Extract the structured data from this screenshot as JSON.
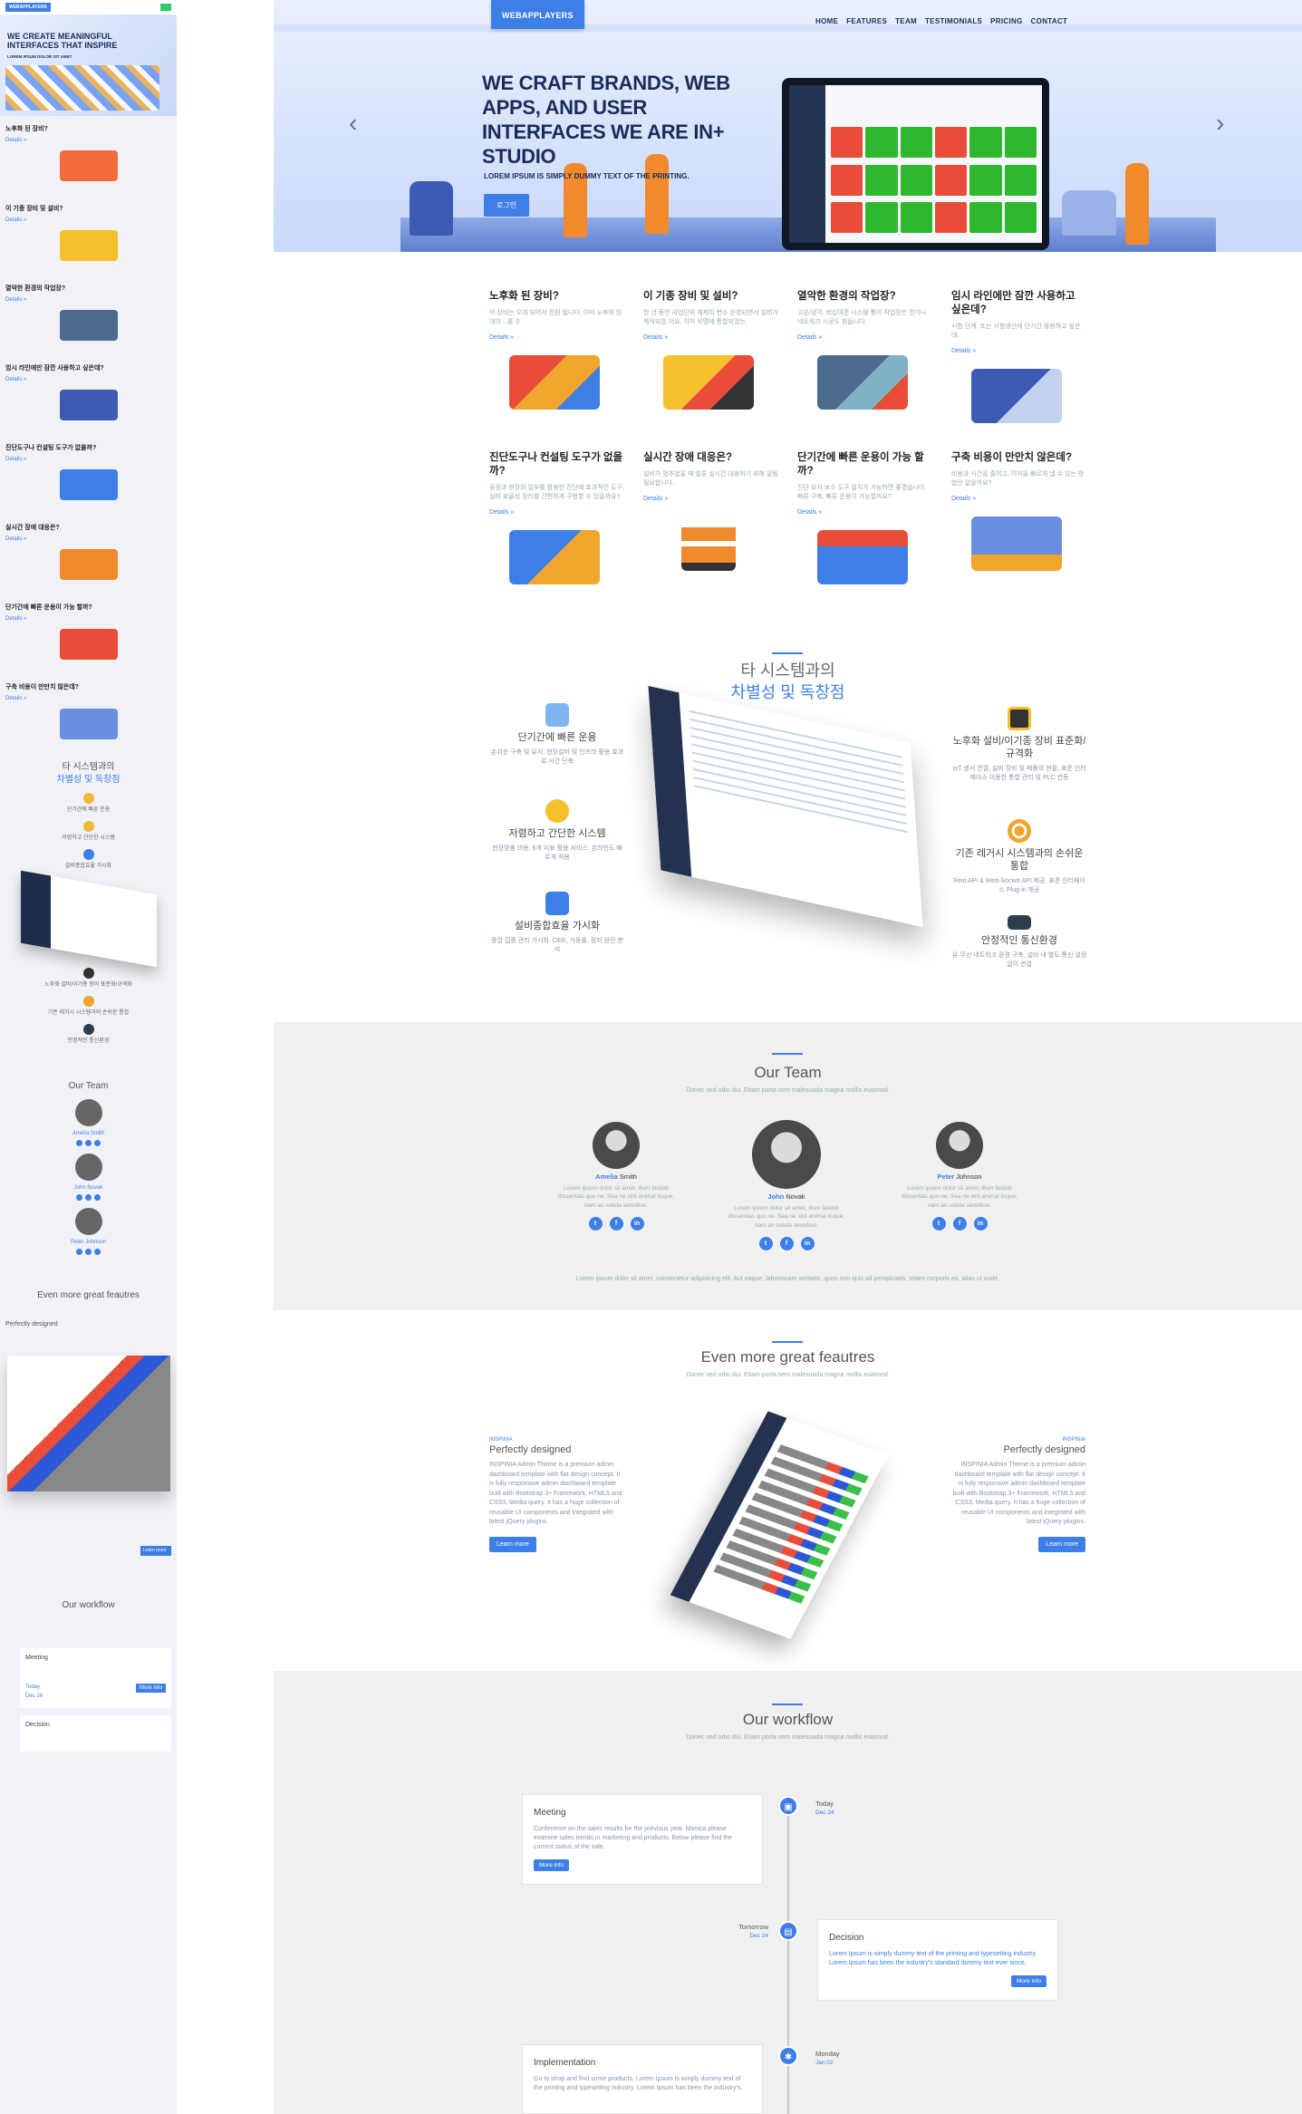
{
  "mobile": {
    "logo": "WEBAPPLAYERS",
    "hero_title": "WE CREATE MEANINGFUL INTERFACES THAT INSPIRE",
    "hero_sub": "LOREM IPSUM DOLOR SIT AMET",
    "sections": [
      {
        "title": "노후화 된 장비?",
        "link": "Details »"
      },
      {
        "title": "이 기종 장비 및 설비?",
        "link": "Details »"
      },
      {
        "title": "열악한 환경의 작업장?",
        "link": "Details »"
      },
      {
        "title": "임시 라인에만 잠깐 사용하고 싶은데?",
        "link": "Details »"
      },
      {
        "title": "진단도구나 컨설팅 도구가 없을까?",
        "link": "Details »"
      },
      {
        "title": "실시간 장애 대응은?",
        "link": "Details »"
      },
      {
        "title": "단기간에 빠른 운용이 가능 할까?",
        "link": "Details »"
      },
      {
        "title": "구축 비용이 만만치 않은데?",
        "link": "Details »"
      }
    ],
    "diff_title_1": "타 시스템과의",
    "diff_title_2": "차별성 및 독창점",
    "mini_items": [
      "단기간에 빠른 운용",
      "저렴하고 간단한 시스템",
      "설비종합효율 가시화"
    ],
    "mini_items_2": [
      "노후화 설비/이기종 장비 표준화/규격화",
      "기존 레거시 시스템과의 손쉬운 통합",
      "안정적인 통신환경"
    ],
    "team_title": "Our Team",
    "members": [
      "Amelia Smith",
      "John Novak",
      "Peter Johnson"
    ],
    "gf_title": "Even more great feautres",
    "gf_col": "Perfectly designed",
    "btn": "Learn more",
    "wf_title": "Our workflow",
    "wf_items": [
      "Meeting",
      "Decision"
    ],
    "wf_more": "More info",
    "wf_today": "Today",
    "wf_date": "Dec 24"
  },
  "nav": {
    "logo": "WEBAPPLAYERS",
    "items": [
      "HOME",
      "FEATURES",
      "TEAM",
      "TESTIMONIALS",
      "PRICING",
      "CONTACT"
    ]
  },
  "hero": {
    "title": "WE CRAFT BRANDS, WEB APPS, AND USER INTERFACES WE ARE IN+ STUDIO",
    "sub": "LOREM IPSUM IS SIMPLY DUMMY TEXT OF THE PRINTING.",
    "button": "로그인",
    "prev": "‹",
    "next": "›",
    "tile_colors": [
      "#e94d3a",
      "#2eb82e",
      "#2eb82e",
      "#e94d3a",
      "#2eb82e",
      "#2eb82e"
    ]
  },
  "features": [
    {
      "title": "노후화 된 장비?",
      "desc": "이 장비는 오래 되어서 전원 됩니다. 이미 노후화 된 데이…를 수",
      "link": "Details »"
    },
    {
      "title": "이 기종 장비 및 설비?",
      "desc": "한 년 동안 사업단위 체제의 변수 운영되면서 설비가 제작되었 어요. 이미 비명에 통합되었는",
      "link": "Details »"
    },
    {
      "title": "열악한 환경의 작업장?",
      "desc": "고온/냉각, 비십여준 시스템 통이 작업장은 전기나 네트워크 시공도 힘듭니다.",
      "link": "Details »"
    },
    {
      "title": "임시 라인에만 잠깐 사용하고 싶은데?",
      "desc": "시험 단계, 또는 시험생산에 단기간 활용하고 싶은데,",
      "link": "Details »"
    },
    {
      "title": "진단도구나 컨설팅 도구가 없을까?",
      "desc": "공정과 현장의 일부를 활용한 진단에 효과적인 도구, 설비 효율성 정리를 간편하게 구현할 수 있을까요?",
      "link": "Details »"
    },
    {
      "title": "실시간 장애 대응은?",
      "desc": "설비가 멈추었을 때 얼른 실시간 대응하기 위해 알림 필요합니다.",
      "link": "Details »"
    },
    {
      "title": "단기간에 빠른 운용이 가능 할까?",
      "desc": "진단 유지 보수 도구 설치가 가능하면 좋겠습니다. 빠른 구축, 빠른 운용이 가능할까요?",
      "link": "Details »"
    },
    {
      "title": "구축 비용이 만만치 않은데?",
      "desc": "비용과 시간을 줄이고, 이익을 빠르게 낼 수 있는 방법은 없을까요?",
      "link": "Details »"
    }
  ],
  "diff": {
    "title_1": "타 시스템과의",
    "title_2": "차별성 및 독창점",
    "left": [
      {
        "title": "단기간에 빠른 운용",
        "desc": "손쉬운 구축 및 유지, 현장설비 및 인프라 활용 효과로 시간 단축"
      },
      {
        "title": "저렴하고 간단한 시스템",
        "desc": "현장맞춤 비용, 6개 지표 활용 서비스, 온라인도 빠르게 적용"
      },
      {
        "title": "설비종합효율 가시화",
        "desc": "중앙 집중 관리 가시화, OEE, 가동률, 정지 원인 분석"
      }
    ],
    "right": [
      {
        "title": "노후화 설비/이기종 장비 표준화/규격화",
        "desc": "IoT 센서 연결, 설비 장비 및 제품의 현황, 표준 인터페이스 이용한 통합 관리 및 PLC 연동"
      },
      {
        "title": "기존 레거시 시스템과의 손쉬운 통합",
        "desc": "Rest API & Web-Socket API 제공, 표준 인터페이스 Plug-in 제공"
      },
      {
        "title": "안정적인 통신환경",
        "desc": "유·무선 네트워크 환경 구축, 설비 내 별도 통신 설정 없이 연결"
      }
    ]
  },
  "team": {
    "title": "Our Team",
    "sub": "Donec sed odio dui. Etiam porta sem malesuada magna mollis euismod.",
    "members": [
      {
        "first": "Amelia",
        "last": "Smith",
        "desc": "Lorem ipsum dolor sit amet, illum fastidii dissentias quo ne. Sea ne sint animal iisque, nam an soluta sensibus."
      },
      {
        "first": "John",
        "last": "Novak",
        "desc": "Lorem ipsum dolor sit amet, illum fastidii dissentias quo ne. Sea ne sint animal iisque, nam an soluta sensibus."
      },
      {
        "first": "Peter",
        "last": "Johnson",
        "desc": "Lorem ipsum dolor sit amet, illum fastidii dissentias quo ne. Sea ne sint animal iisque, nam an soluta sensibus."
      }
    ],
    "social": [
      "t",
      "f",
      "in"
    ],
    "footer": "Lorem ipsum dolor sit amet, consectetur adipisicing elit. Aut eaque, laboriosam veritatis, quos non quis ad perspiciatis, totam corporis ea, alias ut unde."
  },
  "great": {
    "title": "Even more great feautres",
    "sub": "Donec sed odio dui. Etiam porta sem malesuada magna mollis euismod.",
    "left": {
      "tag": "INSPINIA",
      "title": "Perfectly designed",
      "desc": "INSPINIA Admin Theme is a premium admin dashboard template with flat design concept. It is fully responsive admin dashboard template built with Bootstrap 3+ Framework, HTML5 and CSS3, Media query. It has a huge collection of reusable UI components and integrated with latest jQuery plugins.",
      "button": "Learn more"
    },
    "right": {
      "tag": "INSPINIA",
      "title": "Perfectly designed",
      "desc": "INSPINIA Admin Theme is a premium admin dashboard template with flat design concept. It is fully responsive admin dashboard template built with Bootstrap 3+ Framework, HTML5 and CSS3, Media query. It has a huge collection of reusable UI components and integrated with latest jQuery plugins.",
      "button": "Learn more"
    }
  },
  "workflow": {
    "title": "Our workflow",
    "sub": "Donec sed odio dui. Etiam porta sem malesuada magna mollis euismod.",
    "items": [
      {
        "title": "Meeting",
        "desc": "Conference on the sales results for the previous year. Monica please examine sales trends in marketing and products. Below please find the current status of the sale.",
        "button": "More info",
        "when": "Today",
        "date": "Dec 24"
      },
      {
        "title": "Decision",
        "desc": "Lorem Ipsum is simply dummy text of the printing and typesetting industry. Lorem Ipsum has been the industry's standard dummy text ever since.",
        "button": "More info",
        "when": "Tomorrow",
        "date": "Dec 24"
      },
      {
        "title": "Implementation",
        "desc": "Go to shop and find some products. Lorem Ipsum is simply dummy text of the printing and typesetting industry. Lorem Ipsum has been the industry's.",
        "when": "Monday",
        "date": "Jan 02"
      }
    ]
  }
}
